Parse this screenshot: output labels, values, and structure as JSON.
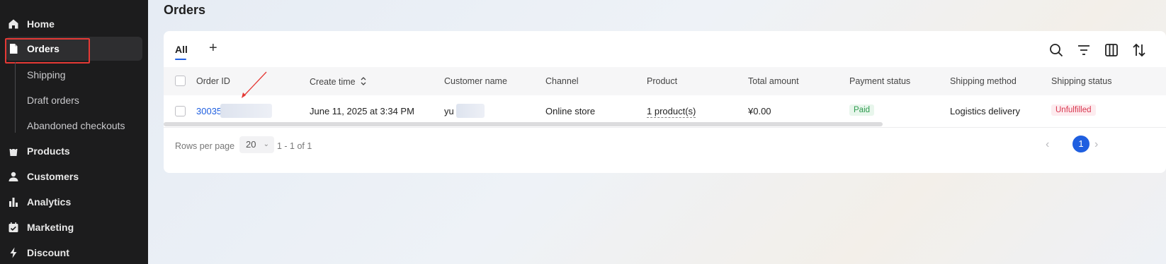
{
  "sidebar": {
    "items": [
      {
        "label": "Home",
        "icon": "home-icon"
      },
      {
        "label": "Orders",
        "icon": "document-icon"
      },
      {
        "label": "Products",
        "icon": "bag-icon"
      },
      {
        "label": "Customers",
        "icon": "user-icon"
      },
      {
        "label": "Analytics",
        "icon": "bar-chart-icon"
      },
      {
        "label": "Marketing",
        "icon": "calendar-check-icon"
      },
      {
        "label": "Discount",
        "icon": "bolt-icon"
      }
    ],
    "sub_items": [
      "Shipping",
      "Draft orders",
      "Abandoned checkouts"
    ]
  },
  "page": {
    "title": "Orders"
  },
  "tabs": {
    "all": "All",
    "add": "+"
  },
  "toolbar": [
    "search-icon",
    "filter-icon",
    "columns-icon",
    "sort-icon"
  ],
  "table": {
    "headers": [
      "Order ID",
      "Create time",
      "Customer name",
      "Channel",
      "Product",
      "Total amount",
      "Payment status",
      "Shipping method",
      "Shipping status"
    ],
    "rows": [
      {
        "order_id": "30035",
        "create_time": "June 11, 2025 at 3:34 PM",
        "customer_name": "yu",
        "channel": "Online store",
        "product": "1 product(s)",
        "total": "¥0.00",
        "payment_status": "Paid",
        "shipping_method": "Logistics delivery",
        "shipping_status": "Unfulfilled"
      }
    ]
  },
  "pagination": {
    "rows_per_page_label": "Rows per page",
    "rows_per_page": "20",
    "range": "1 - 1 of 1",
    "current_page": "1"
  },
  "colors": {
    "accent": "#1f5fe0",
    "paid": "#2e9b4e",
    "unfulfilled": "#d9364f",
    "annotation": "#e53935"
  }
}
